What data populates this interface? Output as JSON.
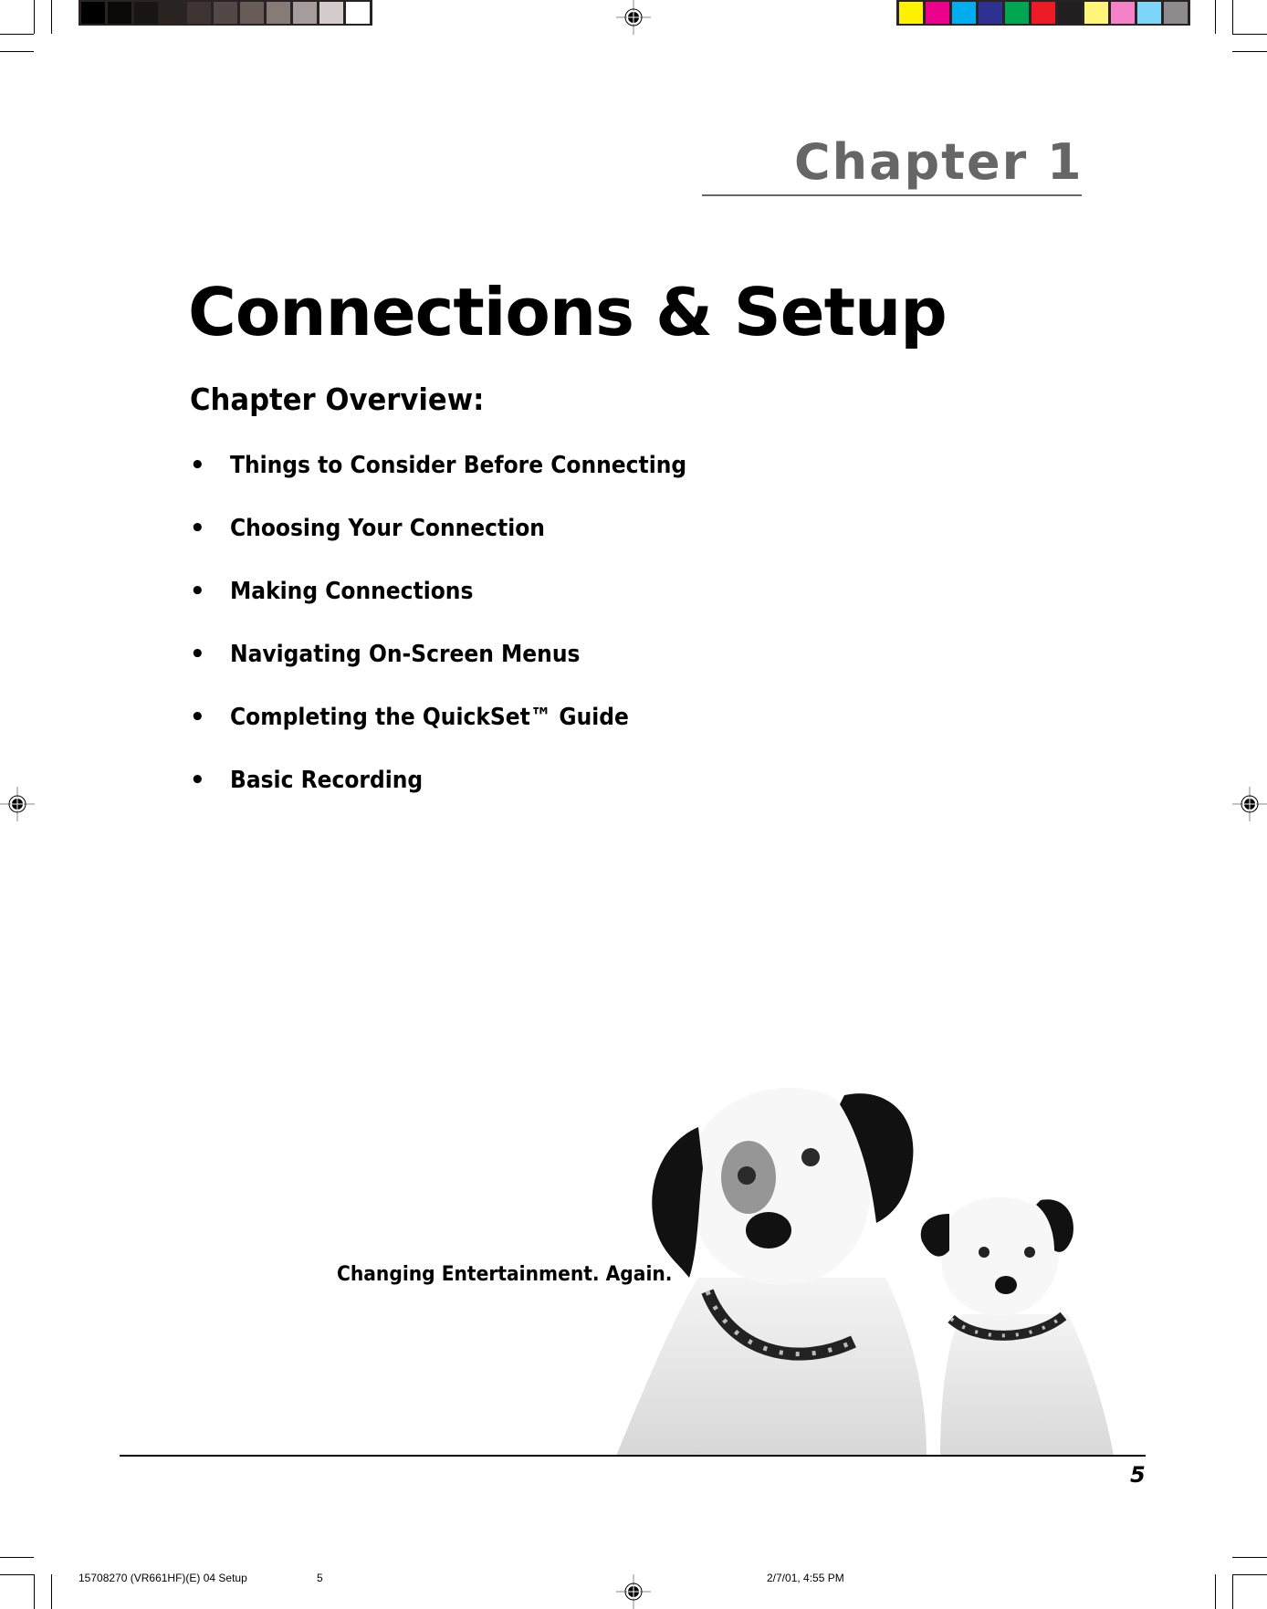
{
  "printer_marks": {
    "gray_swatches": [
      "#000000",
      "#0b0908",
      "#191514",
      "#2a2420",
      "#3e3532",
      "#524845",
      "#675c58",
      "#867b77",
      "#a69d9a",
      "#d4cccb",
      "#ffffff"
    ],
    "color_swatches": [
      "#fff200",
      "#ec008c",
      "#00aeef",
      "#2e3192",
      "#00a651",
      "#ed1c24",
      "#231f20",
      "#fff57a",
      "#f582c8",
      "#7dd6f8",
      "#8d8b8b"
    ]
  },
  "header": {
    "chapter_label": "Chapter 1"
  },
  "main": {
    "title": "Connections & Setup",
    "overview_heading": "Chapter Overview:",
    "bullet_char": "•",
    "overview_items": [
      "Things to Consider Before Connecting",
      "Choosing Your Connection",
      "Making Connections",
      "Navigating On-Screen Menus",
      "Completing the QuickSet™  Guide",
      "Basic Recording"
    ],
    "tagline": "Changing Entertainment. Again.",
    "image_icon": "two-dogs-photo"
  },
  "footer": {
    "page_number": "5",
    "slug_file": "15708270 (VR661HF)(E) 04 Setup",
    "slug_page": "5",
    "slug_timestamp": "2/7/01, 4:55 PM"
  }
}
